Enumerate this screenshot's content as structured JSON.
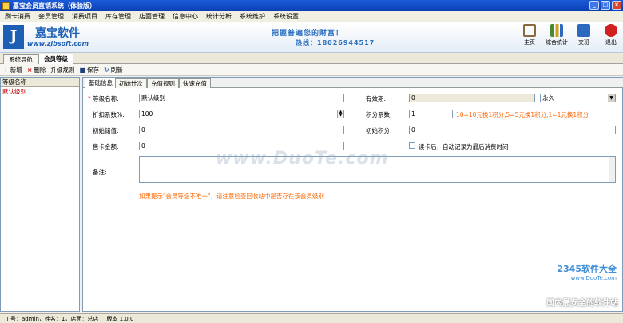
{
  "window": {
    "title": "嘉宝会员直销系统（体验版）"
  },
  "menu": [
    "刷卡消费",
    "会员管理",
    "消费项目",
    "库存管理",
    "店面管理",
    "信息中心",
    "统计分析",
    "系统维护",
    "系统设置"
  ],
  "banner": {
    "logo_letter": "J",
    "logo_name": "嘉宝软件",
    "logo_url": "www.zjbsoft.com",
    "slogan": "把握普遍您的财富！",
    "phone": "热线：18026944517"
  },
  "tools": [
    {
      "label": "主页",
      "icon": "home-icon",
      "color": "#8a6a3c"
    },
    {
      "label": "综合统计",
      "icon": "bar-chart-icon",
      "color": "#4a8a2c"
    },
    {
      "label": "交班",
      "icon": "exchange-icon",
      "color": "#2c6ac0"
    },
    {
      "label": "退出",
      "icon": "power-icon",
      "color": "#d02020"
    }
  ],
  "navtabs": [
    "系统导航",
    "会员等级"
  ],
  "toolbar": {
    "add": "新增",
    "delete": "删除",
    "upgrade": "升级规则",
    "save": "保存",
    "refresh": "刷新"
  },
  "left": {
    "header": "等级名称",
    "rows": [
      "默认级别"
    ]
  },
  "subtabs": [
    "基础信息",
    "初始计次",
    "充值规则",
    "快速充值"
  ],
  "form": {
    "level_name_label": "等级名称:",
    "level_name_value": "默认级别",
    "discount_label": "折扣系数%:",
    "discount_value": "100",
    "init_stored_label": "初始储值:",
    "init_stored_value": "0",
    "card_amount_label": "售卡金额:",
    "card_amount_value": "0",
    "validity_label": "有效期:",
    "validity_value": "0",
    "validity_select": "永久",
    "points_label": "积分系数:",
    "points_value": "1",
    "points_hint": "10=10元换1积分,5=5元换1积分,1=1元换1积分",
    "init_points_label": "初始积分:",
    "init_points_value": "0",
    "checkbox_label": "读卡后，自动记录为最后消费时间",
    "remark_label": "备注:",
    "bottom_hint": "如果提示\"会员等级不唯一\"，请注意检查回收站中是否存在该会员级别"
  },
  "watermarks": {
    "duote": "www.DuoTe.com",
    "k2345": "2345软件大全",
    "k2345_url": "www.DuoTe.com",
    "safe": "国内最安全的软件站"
  },
  "status": {
    "user": "工号：admin，姓名：1，店面：总店",
    "version": "版本 1.0.0"
  }
}
